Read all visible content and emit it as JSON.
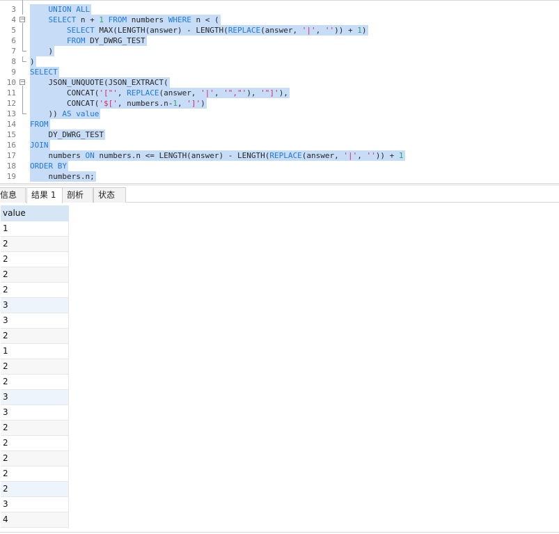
{
  "editor": {
    "lines": [
      {
        "num": "3",
        "segments": [
          {
            "c": "kw",
            "t": "    UNION ALL"
          }
        ]
      },
      {
        "num": "4",
        "segments": [
          {
            "c": "kw",
            "t": "    SELECT"
          },
          {
            "c": "tx",
            "t": " n + "
          },
          {
            "c": "nm",
            "t": "1"
          },
          {
            "c": "kw",
            "t": " FROM"
          },
          {
            "c": "tx",
            "t": " numbers "
          },
          {
            "c": "kw",
            "t": "WHERE"
          },
          {
            "c": "tx",
            "t": " n < ("
          }
        ]
      },
      {
        "num": "5",
        "segments": [
          {
            "c": "kw",
            "t": "        SELECT"
          },
          {
            "c": "tx",
            "t": " MAX(LENGTH(answer) - LENGTH("
          },
          {
            "c": "fnb",
            "t": "REPLACE"
          },
          {
            "c": "tx",
            "t": "(answer, "
          },
          {
            "c": "st",
            "t": "'|'"
          },
          {
            "c": "tx",
            "t": ", "
          },
          {
            "c": "st",
            "t": "''"
          },
          {
            "c": "tx",
            "t": ")) + "
          },
          {
            "c": "nm",
            "t": "1"
          },
          {
            "c": "tx",
            "t": ")"
          }
        ]
      },
      {
        "num": "6",
        "segments": [
          {
            "c": "kw",
            "t": "        FROM"
          },
          {
            "c": "tx",
            "t": " DY_DWRG_TEST"
          }
        ]
      },
      {
        "num": "7",
        "segments": [
          {
            "c": "tx",
            "t": "    )"
          }
        ]
      },
      {
        "num": "8",
        "segments": [
          {
            "c": "tx",
            "t": ")"
          }
        ]
      },
      {
        "num": "9",
        "segments": [
          {
            "c": "kw",
            "t": "SELECT"
          }
        ]
      },
      {
        "num": "10",
        "segments": [
          {
            "c": "tx",
            "t": "    JSON_UNQUOTE(JSON_EXTRACT("
          }
        ]
      },
      {
        "num": "11",
        "segments": [
          {
            "c": "tx",
            "t": "        CONCAT("
          },
          {
            "c": "st",
            "t": "'[\"'"
          },
          {
            "c": "tx",
            "t": ", "
          },
          {
            "c": "fnb",
            "t": "REPLACE"
          },
          {
            "c": "tx",
            "t": "(answer, "
          },
          {
            "c": "st",
            "t": "'|'"
          },
          {
            "c": "tx",
            "t": ", "
          },
          {
            "c": "st",
            "t": "'\",\"'"
          },
          {
            "c": "tx",
            "t": "), "
          },
          {
            "c": "st",
            "t": "'\"]'"
          },
          {
            "c": "tx",
            "t": "),"
          }
        ]
      },
      {
        "num": "12",
        "segments": [
          {
            "c": "tx",
            "t": "        CONCAT("
          },
          {
            "c": "st",
            "t": "'$['"
          },
          {
            "c": "tx",
            "t": ", numbers.n-"
          },
          {
            "c": "nm",
            "t": "1"
          },
          {
            "c": "tx",
            "t": ", "
          },
          {
            "c": "st",
            "t": "']'"
          },
          {
            "c": "tx",
            "t": ")"
          }
        ]
      },
      {
        "num": "13",
        "segments": [
          {
            "c": "tx",
            "t": "    )) "
          },
          {
            "c": "kw",
            "t": "AS value"
          }
        ]
      },
      {
        "num": "14",
        "segments": [
          {
            "c": "kw",
            "t": "FROM"
          }
        ]
      },
      {
        "num": "15",
        "segments": [
          {
            "c": "tx",
            "t": "    DY_DWRG_TEST"
          }
        ]
      },
      {
        "num": "16",
        "segments": [
          {
            "c": "kw",
            "t": "JOIN"
          }
        ]
      },
      {
        "num": "17",
        "segments": [
          {
            "c": "tx",
            "t": "    numbers "
          },
          {
            "c": "kw",
            "t": "ON"
          },
          {
            "c": "tx",
            "t": " numbers.n <= LENGTH(answer) - LENGTH("
          },
          {
            "c": "fnb",
            "t": "REPLACE"
          },
          {
            "c": "tx",
            "t": "(answer, "
          },
          {
            "c": "st",
            "t": "'|'"
          },
          {
            "c": "tx",
            "t": ", "
          },
          {
            "c": "st",
            "t": "''"
          },
          {
            "c": "tx",
            "t": ")) + "
          },
          {
            "c": "nm",
            "t": "1"
          }
        ]
      },
      {
        "num": "18",
        "segments": [
          {
            "c": "kw",
            "t": "ORDER BY"
          }
        ]
      },
      {
        "num": "19",
        "segments": [
          {
            "c": "tx",
            "t": "    numbers.n;"
          }
        ]
      }
    ]
  },
  "tabs": [
    {
      "label": "信息",
      "active": false
    },
    {
      "label": "结果 1",
      "active": true
    },
    {
      "label": "剖析",
      "active": false
    },
    {
      "label": "状态",
      "active": false
    }
  ],
  "grid": {
    "column": "value",
    "rows": [
      "1",
      "2",
      "2",
      "2",
      "2",
      "3",
      "3",
      "2",
      "1",
      "2",
      "2",
      "3",
      "3",
      "2",
      "2",
      "2",
      "2",
      "2",
      "3",
      "4"
    ]
  },
  "colors": {
    "selection": "#c7dcf7",
    "keyword": "#1e78e6",
    "string": "#e0245e",
    "number": "#2aa36b",
    "grid_header": "#d6e6f5"
  }
}
